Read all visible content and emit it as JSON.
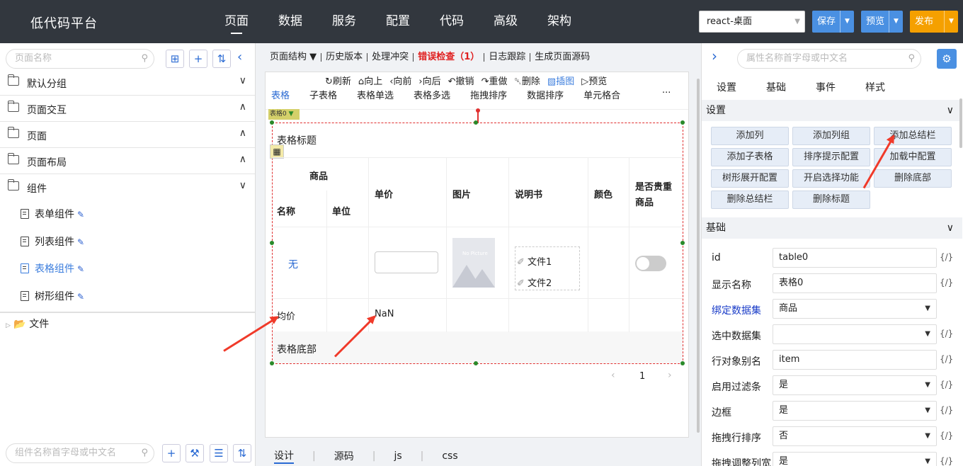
{
  "app": {
    "title": "低代码平台"
  },
  "nav": [
    "页面",
    "数据",
    "服务",
    "配置",
    "代码",
    "高级",
    "架构"
  ],
  "header": {
    "env": "react-桌面",
    "save": "保存",
    "preview": "预览",
    "publish": "发布"
  },
  "left": {
    "search_placeholder": "页面名称",
    "groups": [
      "默认分组",
      "页面交互",
      "页面",
      "页面布局",
      "组件"
    ],
    "components": [
      "表单组件",
      "列表组件",
      "表格组件",
      "树形组件"
    ],
    "file_node": "文件",
    "bottom_search_placeholder": "组件名称首字母或中文名"
  },
  "middle": {
    "toolbar": [
      "页面结构",
      "历史版本",
      "处理冲突",
      "错误检查（1）",
      "日志跟踪",
      "生成页面源码"
    ],
    "actions": [
      "刷新",
      "向上",
      "向前",
      "向后",
      "撤销",
      "重做",
      "删除",
      "插图",
      "预览"
    ],
    "tabs": [
      "表格",
      "子表格",
      "表格单选",
      "表格多选",
      "拖拽排序",
      "数据排序",
      "单元格合"
    ],
    "more": "···",
    "badge": "表格0",
    "table": {
      "title": "表格标题",
      "group_header": "商品",
      "cols": [
        "名称",
        "单位",
        "单价",
        "图片",
        "说明书",
        "颜色",
        "是否贵重商品"
      ],
      "row_name": "无",
      "files": [
        "文件1",
        "文件2"
      ],
      "img_caption": "No Picture",
      "avg_label": "均价",
      "avg_value": "NaN",
      "footer": "表格底部"
    },
    "pager": {
      "page": "1"
    },
    "bottom_tabs": [
      "设计",
      "源码",
      "js",
      "css"
    ]
  },
  "right": {
    "search_placeholder": "属性名称首字母或中文名",
    "tabs": [
      "设置",
      "基础",
      "事件",
      "样式"
    ],
    "section_settings": "设置",
    "buttons": [
      "添加列",
      "添加列组",
      "添加总结栏",
      "添加子表格",
      "排序提示配置",
      "加载中配置",
      "树形展开配置",
      "开启选择功能",
      "删除底部",
      "删除总结栏",
      "删除标题"
    ],
    "section_basic": "基础",
    "props": [
      {
        "label": "id",
        "value": "table0"
      },
      {
        "label": "显示名称",
        "value": "表格0"
      },
      {
        "label": "绑定数据集",
        "value": "商品"
      },
      {
        "label": "选中数据集",
        "value": ""
      },
      {
        "label": "行对象别名",
        "value": "item"
      },
      {
        "label": "启用过滤条",
        "value": "是"
      },
      {
        "label": "边框",
        "value": "是"
      },
      {
        "label": "拖拽行排序",
        "value": "否"
      },
      {
        "label": "拖拽调整列宽",
        "value": "是"
      }
    ],
    "code_icon": "{/}"
  }
}
